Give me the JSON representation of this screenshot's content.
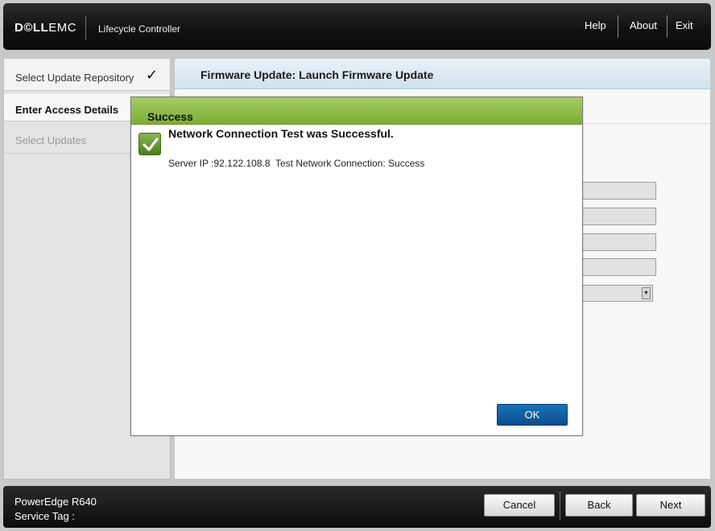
{
  "header": {
    "brand_bold": "D©LL",
    "brand_light": "EMC",
    "app_name": "Lifecycle Controller",
    "links": {
      "help": "Help",
      "about": "About",
      "exit": "Exit"
    }
  },
  "sidebar": {
    "steps": [
      {
        "label": "Select Update Repository",
        "state": "done"
      },
      {
        "label": "Enter Access Details",
        "state": "current"
      },
      {
        "label": "Select Updates",
        "state": "pending"
      }
    ],
    "check_icon": "checkmark-icon"
  },
  "main": {
    "title": "Firmware Update: Launch Firmware Update"
  },
  "modal": {
    "title": "Success",
    "icon": "success-check-icon",
    "heading": "Network Connection Test was Successful.",
    "message": "Server IP :92.122.108.8  Test Network Connection: Success",
    "ok_label": "OK"
  },
  "footer": {
    "model": "PowerEdge R640",
    "service_tag": "Service Tag :",
    "buttons": {
      "cancel": "Cancel",
      "back": "Back",
      "next": "Next"
    }
  },
  "colors": {
    "success_header": "#8bb843",
    "primary_button": "#0f5c9e",
    "header_bg": "#1a1a1a"
  }
}
